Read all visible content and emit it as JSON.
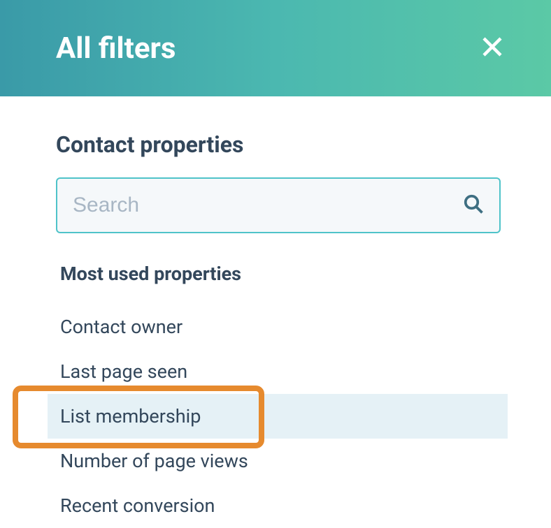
{
  "header": {
    "title": "All filters"
  },
  "section": {
    "title": "Contact properties"
  },
  "search": {
    "placeholder": "Search",
    "value": ""
  },
  "group": {
    "label": "Most used properties"
  },
  "properties": [
    {
      "label": "Contact owner",
      "highlighted": false
    },
    {
      "label": "Last page seen",
      "highlighted": false
    },
    {
      "label": "List membership",
      "highlighted": true
    },
    {
      "label": "Number of page views",
      "highlighted": false
    },
    {
      "label": "Recent conversion",
      "highlighted": false
    }
  ]
}
